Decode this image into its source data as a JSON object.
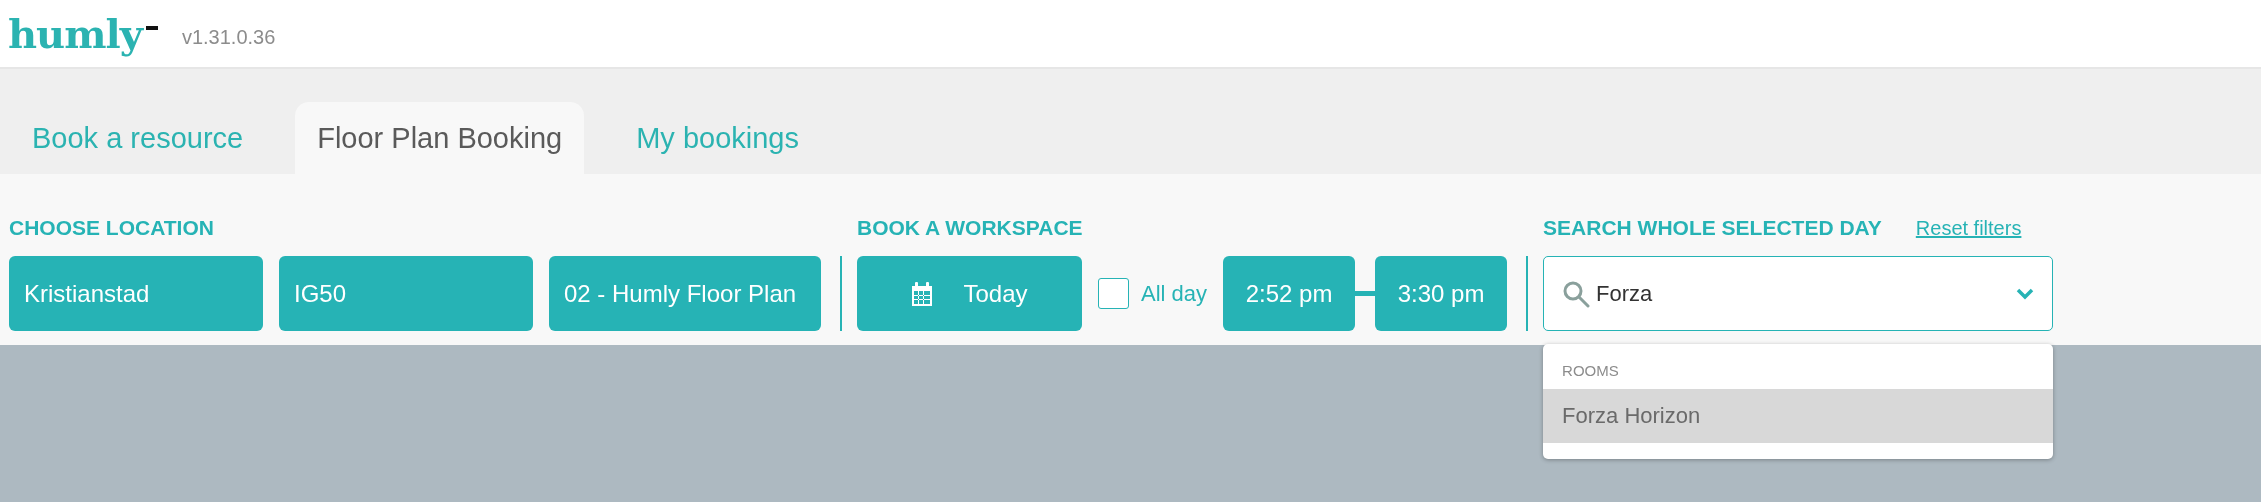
{
  "header": {
    "logo": "humly",
    "version": "v1.31.0.36"
  },
  "tabs": [
    {
      "label": "Book a resource",
      "selected": false
    },
    {
      "label": "Floor Plan Booking",
      "selected": true
    },
    {
      "label": "My bookings",
      "selected": false
    }
  ],
  "location": {
    "title": "CHOOSE LOCATION",
    "buttons": [
      "Kristianstad",
      "IG50",
      "02 - Humly Floor Plan"
    ]
  },
  "workspace": {
    "title": "BOOK A WORKSPACE",
    "date": "Today",
    "all_day": {
      "label": "All day",
      "checked": false
    },
    "start": "2:52 pm",
    "end": "3:30 pm"
  },
  "search": {
    "title": "SEARCH WHOLE SELECTED DAY",
    "reset": "Reset filters",
    "value": "Forza",
    "dropdown": {
      "group": "ROOMS",
      "items": [
        {
          "label": "Forza Horizon",
          "selected": true
        }
      ]
    }
  }
}
